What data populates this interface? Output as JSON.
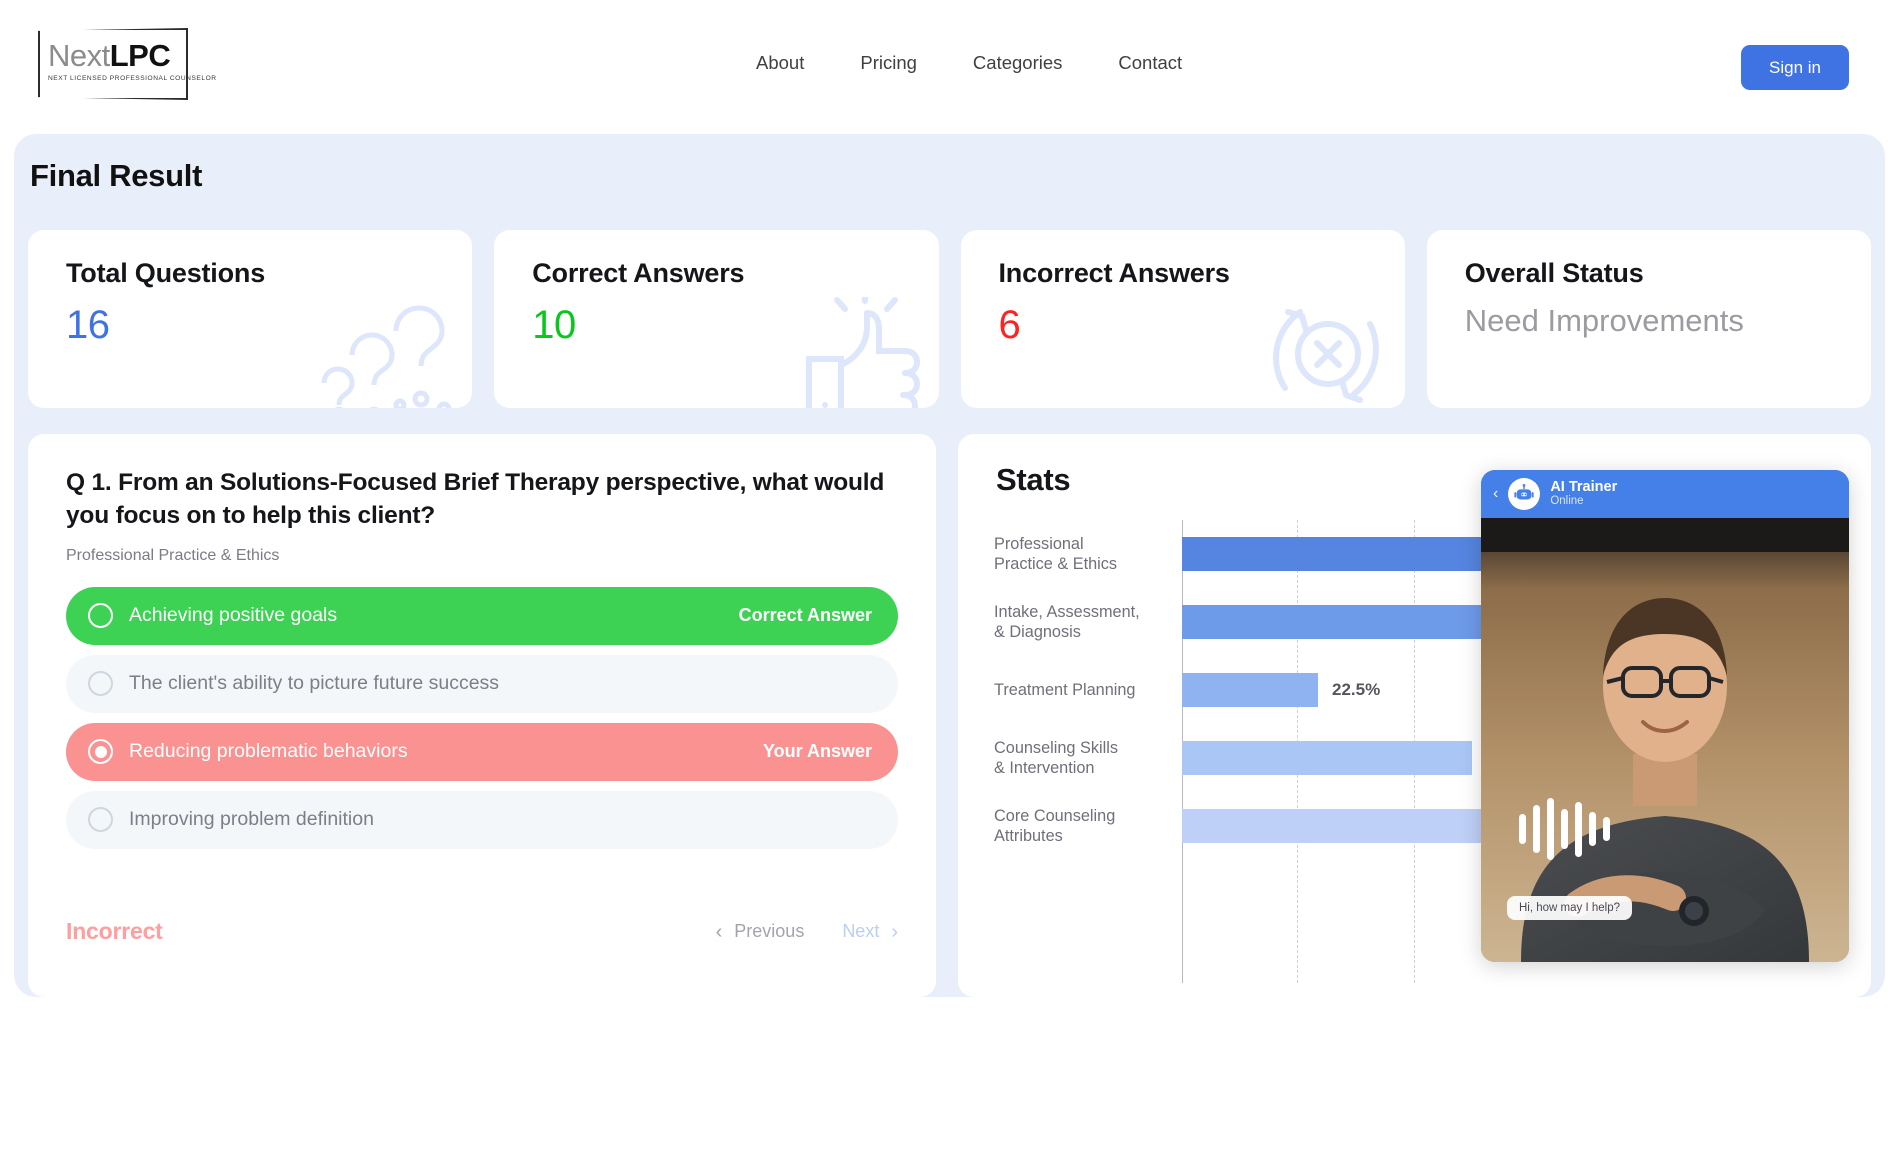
{
  "header": {
    "logo": {
      "name_light": "Next",
      "name_bold": "LPC",
      "tagline": "NEXT LICENSED PROFESSIONAL COUNSELOR"
    },
    "nav": [
      {
        "label": "About"
      },
      {
        "label": "Pricing"
      },
      {
        "label": "Categories"
      },
      {
        "label": "Contact"
      }
    ],
    "signin_label": "Sign in"
  },
  "result": {
    "title": "Final Result",
    "cards": [
      {
        "title": "Total Questions",
        "value": "16",
        "color": "#3f72e3",
        "icon": "question-marks-icon"
      },
      {
        "title": "Correct Answers",
        "value": "10",
        "color": "#08c81e",
        "icon": "thumbs-up-icon"
      },
      {
        "title": "Incorrect Answers",
        "value": "6",
        "color": "#ff2222",
        "icon": "retry-error-icon"
      },
      {
        "title": "Overall Status",
        "status": "Need Improvements",
        "color": "#9b9ba1",
        "icon": "none"
      }
    ]
  },
  "question": {
    "prompt": "Q 1. From an Solutions-Focused Brief Therapy perspective, what would you focus on to help this client?",
    "category": "Professional Practice & Ethics",
    "options": [
      {
        "label": "Achieving positive goals",
        "tag": "Correct Answer",
        "state": "correct",
        "selected": false
      },
      {
        "label": "The client's ability to picture future success",
        "tag": "",
        "state": "neutral",
        "selected": false
      },
      {
        "label": "Reducing problematic behaviors",
        "tag": "Your Answer",
        "state": "wrong",
        "selected": true
      },
      {
        "label": "Improving problem definition",
        "tag": "",
        "state": "neutral",
        "selected": false
      }
    ],
    "verdict": "Incorrect",
    "previous_label": "Previous",
    "next_label": "Next"
  },
  "stats": {
    "title": "Stats"
  },
  "chart_data": {
    "type": "bar",
    "orientation": "horizontal",
    "title": "Stats",
    "xlabel": "",
    "ylabel": "",
    "xlim": [
      0,
      60
    ],
    "grid": true,
    "gridlines": [
      20,
      40
    ],
    "legend": "none",
    "categories": [
      "Professional\nPractice & Ethics",
      "Intake, Assessment,\n& Diagnosis",
      "Treatment Planning",
      "Counseling Skills\n& Intervention",
      "Core Counseling\nAttributes"
    ],
    "values": [
      57,
      56.5,
      22.5,
      48,
      55
    ],
    "value_labels": [
      "",
      "",
      "22.5%",
      "",
      ""
    ],
    "colors": [
      "#5585e0",
      "#6e9aea",
      "#8fb2f0",
      "#aac6f4",
      "#bed0f7"
    ]
  },
  "ai_widget": {
    "name": "AI Trainer",
    "status": "Online",
    "back_icon": "chevron-left-icon",
    "avatar_icon": "robot-icon",
    "bubble_text": "Hi, how may I help?",
    "waveform_icon": "audio-waveform-icon"
  }
}
